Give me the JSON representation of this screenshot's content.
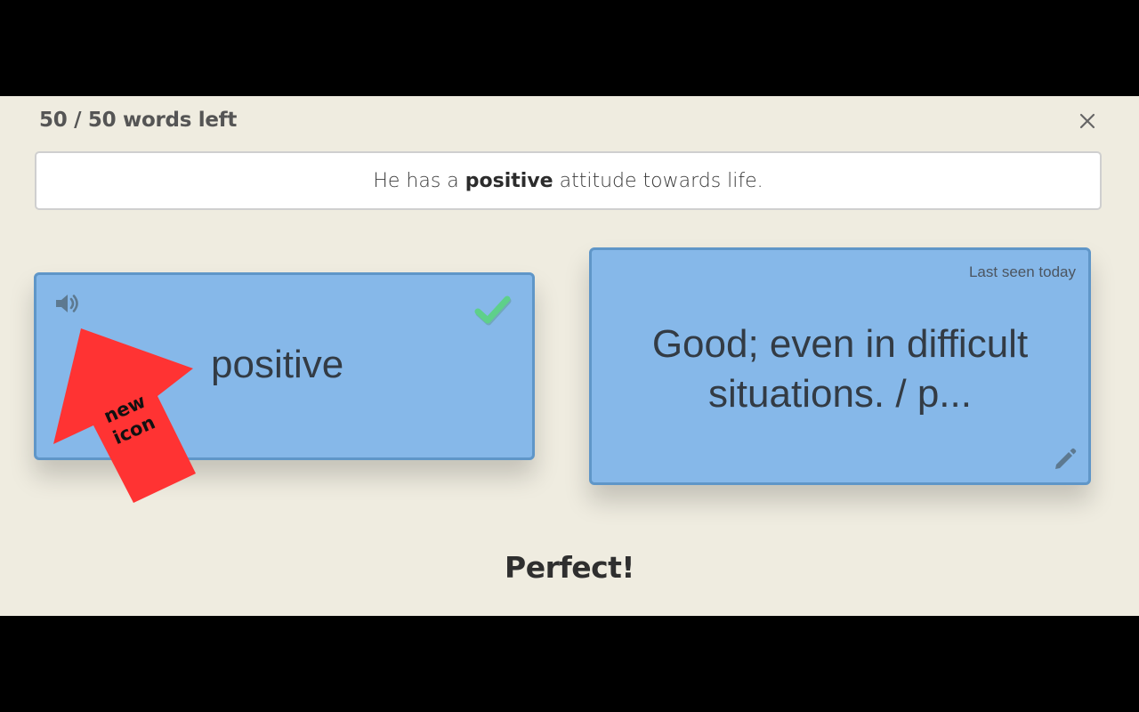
{
  "progress": {
    "counter_text": "50 / 50 words left"
  },
  "header": {
    "close_icon": "close-icon"
  },
  "sentence": {
    "before": "He has a",
    "keyword": "positive",
    "after": "attitude towards life."
  },
  "front_card": {
    "word": "positive",
    "audio_icon": "speaker-icon",
    "status_icon": "check-icon"
  },
  "back_card": {
    "last_seen": "Last seen today",
    "definition": "Good; even in difficult situations. / p...",
    "edit_icon": "pencil-icon"
  },
  "feedback": {
    "text": "Perfect!"
  },
  "annotation": {
    "text_line1": "new",
    "text_line2": "icon"
  },
  "colors": {
    "background": "#efece0",
    "card": "#86b8e9",
    "card_border": "#5f96c8",
    "check": "#5ed08a",
    "arrow": "#ff3333"
  }
}
